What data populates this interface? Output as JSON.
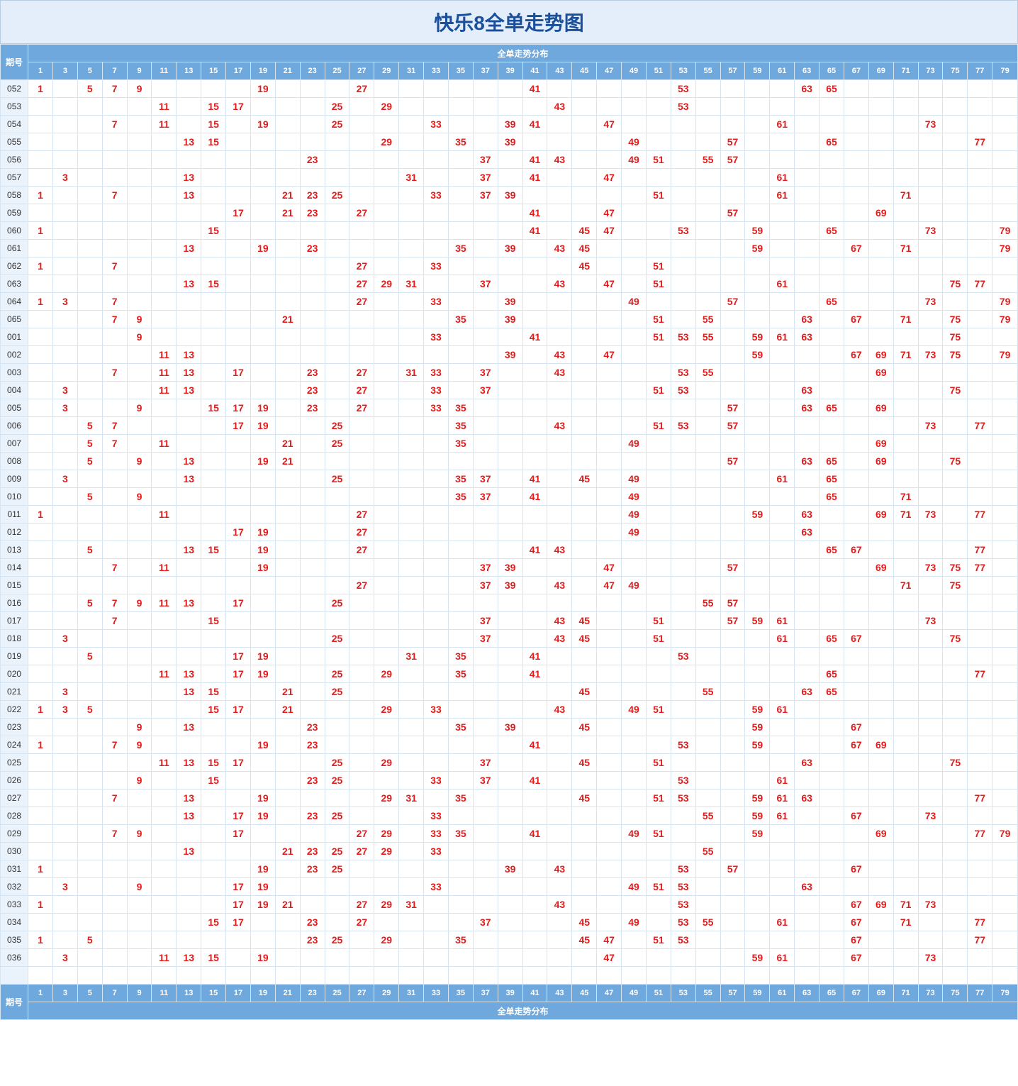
{
  "title": "快乐8全单走势图",
  "row_label_header": "期号",
  "group_header": "全单走势分布",
  "columns": [
    1,
    3,
    5,
    7,
    9,
    11,
    13,
    15,
    17,
    19,
    21,
    23,
    25,
    27,
    29,
    31,
    33,
    35,
    37,
    39,
    41,
    43,
    45,
    47,
    49,
    51,
    53,
    55,
    57,
    59,
    61,
    63,
    65,
    67,
    69,
    71,
    73,
    75,
    77,
    79
  ],
  "chart_data": {
    "type": "table",
    "title": "快乐8全单走势图",
    "rows": [
      {
        "id": "052",
        "nums": [
          1,
          5,
          7,
          9,
          19,
          27,
          41,
          53,
          63,
          65
        ]
      },
      {
        "id": "053",
        "nums": [
          11,
          15,
          17,
          25,
          29,
          43,
          53
        ]
      },
      {
        "id": "054",
        "nums": [
          7,
          11,
          15,
          19,
          25,
          33,
          39,
          41,
          47,
          61,
          73
        ]
      },
      {
        "id": "055",
        "nums": [
          13,
          15,
          29,
          35,
          39,
          49,
          57,
          65,
          77
        ]
      },
      {
        "id": "056",
        "nums": [
          23,
          37,
          41,
          43,
          49,
          51,
          55,
          57
        ]
      },
      {
        "id": "057",
        "nums": [
          3,
          13,
          31,
          37,
          41,
          47,
          61
        ]
      },
      {
        "id": "058",
        "nums": [
          1,
          7,
          13,
          21,
          23,
          25,
          33,
          37,
          39,
          51,
          61,
          71
        ]
      },
      {
        "id": "059",
        "nums": [
          17,
          21,
          23,
          27,
          41,
          47,
          57,
          69
        ]
      },
      {
        "id": "060",
        "nums": [
          1,
          15,
          41,
          45,
          47,
          53,
          59,
          65,
          73,
          79
        ]
      },
      {
        "id": "061",
        "nums": [
          13,
          19,
          23,
          35,
          39,
          43,
          45,
          59,
          67,
          71,
          79
        ]
      },
      {
        "id": "062",
        "nums": [
          1,
          7,
          27,
          33,
          45,
          51
        ]
      },
      {
        "id": "063",
        "nums": [
          13,
          15,
          27,
          29,
          31,
          37,
          43,
          47,
          51,
          61,
          75,
          77
        ]
      },
      {
        "id": "064",
        "nums": [
          1,
          3,
          7,
          27,
          33,
          39,
          49,
          57,
          65,
          73,
          79
        ]
      },
      {
        "id": "065",
        "nums": [
          7,
          9,
          21,
          35,
          39,
          51,
          55,
          63,
          67,
          71,
          75,
          79
        ]
      },
      {
        "id": "001",
        "nums": [
          9,
          33,
          41,
          51,
          53,
          55,
          59,
          61,
          63,
          75
        ]
      },
      {
        "id": "002",
        "nums": [
          11,
          13,
          39,
          43,
          47,
          59,
          67,
          69,
          71,
          73,
          75,
          79
        ]
      },
      {
        "id": "003",
        "nums": [
          7,
          11,
          13,
          17,
          23,
          27,
          31,
          33,
          37,
          43,
          53,
          55,
          69
        ]
      },
      {
        "id": "004",
        "nums": [
          3,
          11,
          13,
          23,
          27,
          33,
          37,
          51,
          53,
          63,
          75
        ]
      },
      {
        "id": "005",
        "nums": [
          3,
          9,
          15,
          17,
          19,
          23,
          27,
          33,
          35,
          57,
          63,
          65,
          69
        ]
      },
      {
        "id": "006",
        "nums": [
          5,
          7,
          17,
          19,
          25,
          35,
          43,
          51,
          53,
          57,
          73,
          77
        ]
      },
      {
        "id": "007",
        "nums": [
          5,
          7,
          11,
          21,
          25,
          35,
          49,
          69
        ]
      },
      {
        "id": "008",
        "nums": [
          5,
          9,
          13,
          19,
          21,
          57,
          63,
          65,
          69,
          75
        ]
      },
      {
        "id": "009",
        "nums": [
          3,
          13,
          25,
          35,
          37,
          41,
          45,
          49,
          61,
          65
        ]
      },
      {
        "id": "010",
        "nums": [
          5,
          9,
          35,
          37,
          41,
          49,
          65,
          71
        ]
      },
      {
        "id": "011",
        "nums": [
          1,
          11,
          27,
          49,
          59,
          63,
          69,
          71,
          73,
          77
        ]
      },
      {
        "id": "012",
        "nums": [
          17,
          19,
          27,
          49,
          63
        ]
      },
      {
        "id": "013",
        "nums": [
          5,
          13,
          15,
          19,
          27,
          41,
          43,
          65,
          67,
          77
        ]
      },
      {
        "id": "014",
        "nums": [
          7,
          11,
          19,
          37,
          39,
          47,
          57,
          69,
          73,
          75,
          77
        ]
      },
      {
        "id": "015",
        "nums": [
          27,
          37,
          39,
          43,
          47,
          49,
          71,
          75
        ]
      },
      {
        "id": "016",
        "nums": [
          5,
          7,
          9,
          11,
          13,
          17,
          25,
          55,
          57
        ]
      },
      {
        "id": "017",
        "nums": [
          7,
          15,
          37,
          43,
          45,
          51,
          57,
          59,
          61,
          73
        ]
      },
      {
        "id": "018",
        "nums": [
          3,
          25,
          37,
          43,
          45,
          51,
          61,
          65,
          67,
          75
        ]
      },
      {
        "id": "019",
        "nums": [
          5,
          17,
          19,
          31,
          35,
          41,
          53
        ]
      },
      {
        "id": "020",
        "nums": [
          11,
          13,
          17,
          19,
          25,
          29,
          35,
          41,
          65,
          77
        ]
      },
      {
        "id": "021",
        "nums": [
          3,
          13,
          15,
          21,
          25,
          45,
          55,
          63,
          65
        ]
      },
      {
        "id": "022",
        "nums": [
          1,
          3,
          5,
          15,
          17,
          21,
          29,
          33,
          43,
          49,
          51,
          59,
          61
        ]
      },
      {
        "id": "023",
        "nums": [
          9,
          13,
          23,
          35,
          39,
          45,
          59,
          67
        ]
      },
      {
        "id": "024",
        "nums": [
          1,
          7,
          9,
          19,
          23,
          41,
          53,
          59,
          67,
          69
        ]
      },
      {
        "id": "025",
        "nums": [
          11,
          13,
          15,
          17,
          25,
          29,
          37,
          45,
          51,
          63,
          75
        ]
      },
      {
        "id": "026",
        "nums": [
          9,
          15,
          23,
          25,
          33,
          37,
          41,
          53,
          61
        ]
      },
      {
        "id": "027",
        "nums": [
          7,
          13,
          19,
          29,
          31,
          35,
          45,
          51,
          53,
          59,
          61,
          63,
          77
        ]
      },
      {
        "id": "028",
        "nums": [
          13,
          17,
          19,
          23,
          25,
          33,
          55,
          59,
          61,
          67,
          73
        ]
      },
      {
        "id": "029",
        "nums": [
          7,
          9,
          17,
          27,
          29,
          33,
          35,
          41,
          49,
          51,
          59,
          69,
          77,
          79
        ]
      },
      {
        "id": "030",
        "nums": [
          13,
          21,
          23,
          25,
          27,
          29,
          33,
          55
        ]
      },
      {
        "id": "031",
        "nums": [
          1,
          19,
          23,
          25,
          39,
          43,
          53,
          57,
          67
        ]
      },
      {
        "id": "032",
        "nums": [
          3,
          9,
          17,
          19,
          33,
          49,
          51,
          53,
          63
        ]
      },
      {
        "id": "033",
        "nums": [
          1,
          17,
          19,
          21,
          27,
          29,
          31,
          43,
          53,
          67,
          69,
          71,
          73
        ]
      },
      {
        "id": "034",
        "nums": [
          15,
          17,
          23,
          27,
          37,
          45,
          49,
          53,
          55,
          61,
          67,
          71,
          77
        ]
      },
      {
        "id": "035",
        "nums": [
          1,
          5,
          23,
          25,
          29,
          35,
          45,
          47,
          51,
          53,
          67,
          77
        ]
      },
      {
        "id": "036",
        "nums": [
          3,
          11,
          13,
          15,
          19,
          47,
          59,
          61,
          67,
          73
        ]
      }
    ]
  }
}
